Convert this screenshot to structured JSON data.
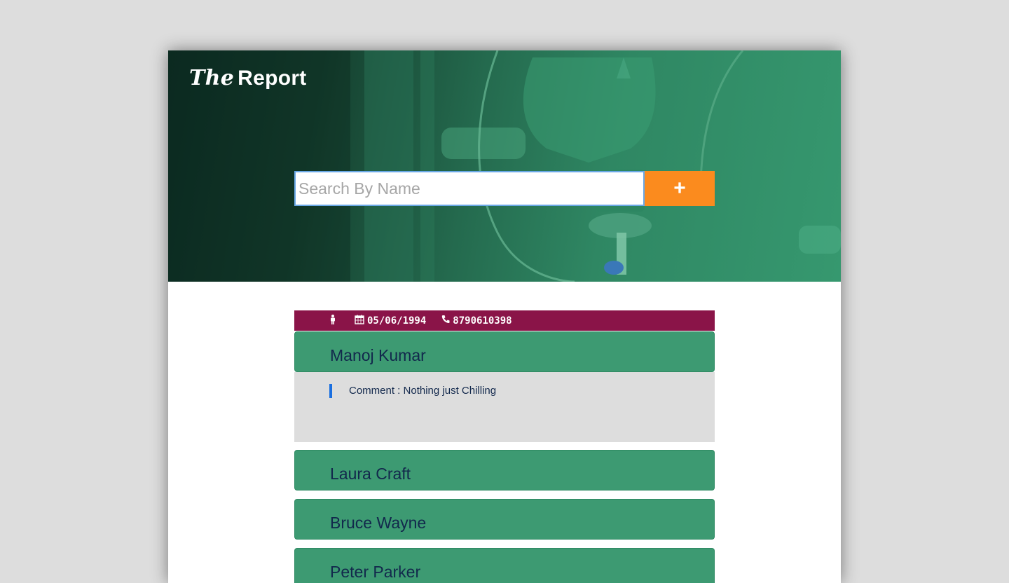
{
  "header": {
    "logo_prefix": "The",
    "logo_word": "Report",
    "search_placeholder": "Search By Name",
    "add_label": "+"
  },
  "selected": {
    "gender_icon": "person-icon",
    "dob": "05/06/1994",
    "phone": "8790610398",
    "name": "Manoj Kumar",
    "comment": "Comment : Nothing just Chilling"
  },
  "people": [
    {
      "name": "Laura Craft"
    },
    {
      "name": "Bruce Wayne"
    },
    {
      "name": "Peter Parker"
    }
  ],
  "colors": {
    "hero_green": "#36986f",
    "info_bar": "#8a1448",
    "entry_green": "#3d9a72",
    "add_button": "#fb8b1e",
    "comment_bg": "#dddddd",
    "comment_bar": "#1a6fe0"
  }
}
